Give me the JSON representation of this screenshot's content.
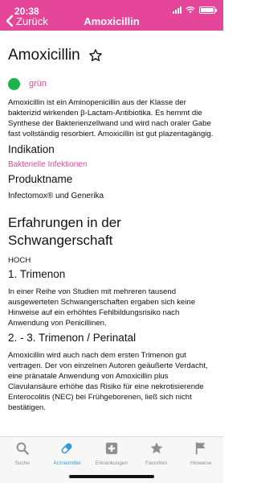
{
  "status_bar": {
    "time": "20:38"
  },
  "nav": {
    "back_label": "Zurück",
    "title": "Amoxicillin"
  },
  "drug": {
    "name": "Amoxicillin",
    "rating_label": "grün",
    "rating_color": "#1bb34a",
    "description": "Amoxicillin ist ein Aminopenicillin aus der Klasse der bakterizid wirkenden β-Lactam-Antibiotika. Es hemmt die Synthese der Bakterienzellwand und wird nach oraler Gabe fast vollständig resorbiert. Amoxicillin ist gut plazentagängig.",
    "indication_heading": "Indikation",
    "indication_link": "Bakterielle Infektionen",
    "product_heading": "Produktname",
    "product_names": "Infectomox® und Generika"
  },
  "experience": {
    "heading": "Erfahrungen in der Schwangerschaft",
    "level": "HOCH",
    "trimester1_heading": "1. Trimenon",
    "trimester1_text": "In einer Reihe von Studien mit mehreren tausend ausgewerteten Schwangerschaften ergaben sich keine Hinweise auf ein erhöhtes Fehlbildungsrisiko nach Anwendung von Penicillinen.",
    "trimester23_heading": "2. - 3. Trimenon / Perinatal",
    "trimester23_text": "Amoxicillin wird auch nach dem ersten Trimenon gut vertragen. Der von einzelnen Autoren geäußerte Verdacht, eine pränatale Anwendung von Amoxicillin plus Clavulansäure erhöhe das Risiko für eine nekrotisierende Enterocolitis (NEC) bei Frühgeborenen, ließ sich nicht bestätigen."
  },
  "tabs": [
    {
      "label": "Suche",
      "icon": "search-icon"
    },
    {
      "label": "Arzneimittel",
      "icon": "pill-icon",
      "active": true
    },
    {
      "label": "Erkrankungen",
      "icon": "medical-cross-icon"
    },
    {
      "label": "Favoriten",
      "icon": "star-icon"
    },
    {
      "label": "Hinweise",
      "icon": "flag-icon"
    }
  ],
  "colors": {
    "accent": "#e5469a",
    "active_tab": "#2f9cd7",
    "inactive_tab": "#8e8e93"
  }
}
